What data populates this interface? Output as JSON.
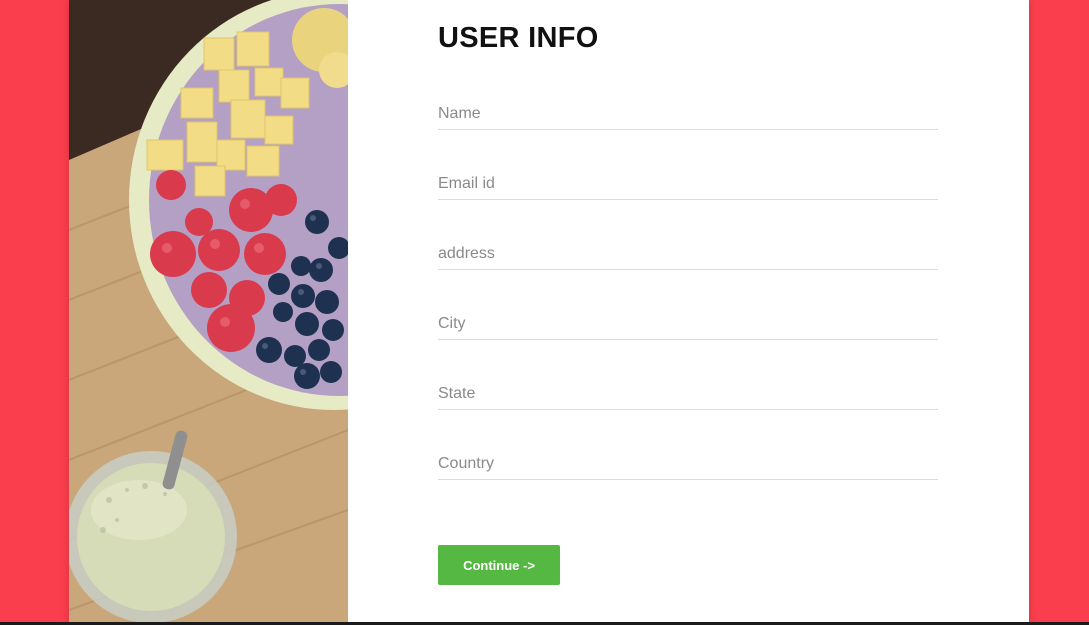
{
  "header": {
    "title": "USER INFO"
  },
  "form": {
    "fields": [
      {
        "placeholder": "Name",
        "value": ""
      },
      {
        "placeholder": "Email id",
        "value": ""
      },
      {
        "placeholder": "address",
        "value": ""
      },
      {
        "placeholder": "City",
        "value": ""
      },
      {
        "placeholder": "State",
        "value": ""
      },
      {
        "placeholder": "Country",
        "value": ""
      }
    ],
    "continue_label": "Continue ->"
  },
  "colors": {
    "background": "#fb3e4d",
    "card": "#ffffff",
    "button": "#55b843",
    "title": "#111111"
  }
}
